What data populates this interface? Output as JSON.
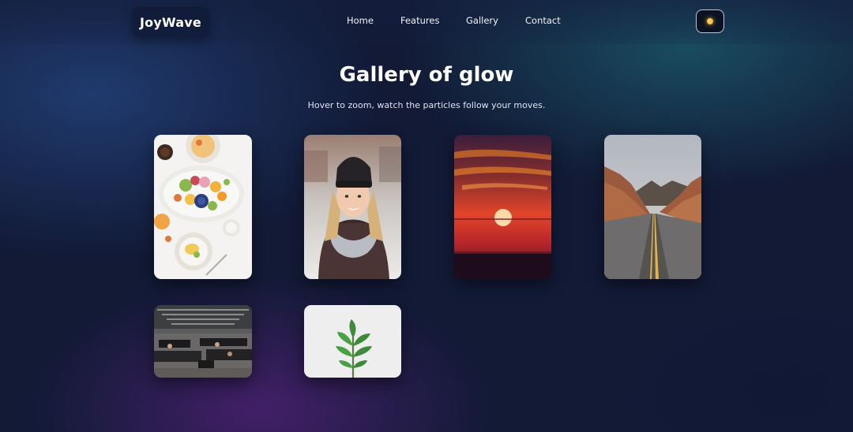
{
  "brand": {
    "name": "JoyWave"
  },
  "nav": {
    "items": [
      {
        "label": "Home"
      },
      {
        "label": "Features"
      },
      {
        "label": "Gallery"
      },
      {
        "label": "Contact"
      }
    ]
  },
  "theme_toggle": {
    "icon": "sun-icon",
    "color": "#f3a81c"
  },
  "hero": {
    "title": "Gallery of glow",
    "subtitle": "Hover to zoom, watch the particles follow your moves."
  },
  "gallery": {
    "items": [
      {
        "subject": "food-platter-photo"
      },
      {
        "subject": "woman-in-beanie-photo"
      },
      {
        "subject": "sunset-photo"
      },
      {
        "subject": "desert-road-photo"
      },
      {
        "subject": "office-interior-photo"
      },
      {
        "subject": "plant-sprout-photo"
      }
    ]
  },
  "colors": {
    "background": "#121a36",
    "accent_teal": "#1c5c6e",
    "accent_purple": "#48206e"
  }
}
